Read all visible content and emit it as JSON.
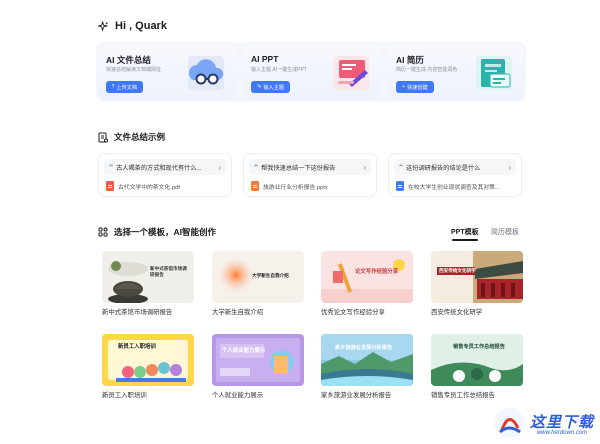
{
  "header": {
    "greeting": "Hi , Quark"
  },
  "features": [
    {
      "title": "AI 文件总结",
      "subtitle": "快速总结解读文档或网址",
      "button": "上传文档"
    },
    {
      "title": "AI PPT",
      "subtitle": "输入主题 AI一键生成PPT",
      "button": "输入主题"
    },
    {
      "title": "AI 简历",
      "subtitle": "简历一键生成 内容智能润色",
      "button": "快速创建"
    }
  ],
  "examples_section": {
    "title": "文件总结示例",
    "items": [
      {
        "question": "古人喝茶的方式和现代有什么...",
        "file": "古代文学中的茶文化.pdf",
        "file_type": "pdf"
      },
      {
        "question": "帮我快速总结一下这份报告",
        "file": "旅游业行业分析报告.pptx",
        "file_type": "ppt"
      },
      {
        "question": "这份调研报告的结论是什么",
        "file": "在校大学生创业现状调查及其对策...",
        "file_type": "doc"
      }
    ]
  },
  "templates_section": {
    "title": "选择一个模板，AI智能创作",
    "tabs": [
      {
        "label": "PPT模板",
        "active": true
      },
      {
        "label": "简历模板",
        "active": false
      }
    ],
    "items": [
      {
        "label": "新中式茶馆市场调研报告",
        "thumb_text": "新中式茶馆市场调研报告"
      },
      {
        "label": "大学新生自我介绍",
        "thumb_text": "大学新生自我介绍"
      },
      {
        "label": "优秀论文写作经验分享",
        "thumb_text": "论文写作经验分享"
      },
      {
        "label": "西安传统文化研学",
        "thumb_text": "西安传统文化研学"
      },
      {
        "label": "新员工入职培训",
        "thumb_text": "新员工入职培训"
      },
      {
        "label": "个人就业能力展示",
        "thumb_text": "个人就业能力展示"
      },
      {
        "label": "家乡旅游业发展分析报告",
        "thumb_text": "家乡旅游业发展分析报告"
      },
      {
        "label": "销售专员工作总结报告",
        "thumb_text": "销售专员工作总结报告"
      }
    ]
  },
  "watermark": {
    "name": "这里下载",
    "url": "www.herdown.com"
  },
  "colors": {
    "accent": "#3f79f5",
    "card_bg": "#f3f6fc"
  }
}
